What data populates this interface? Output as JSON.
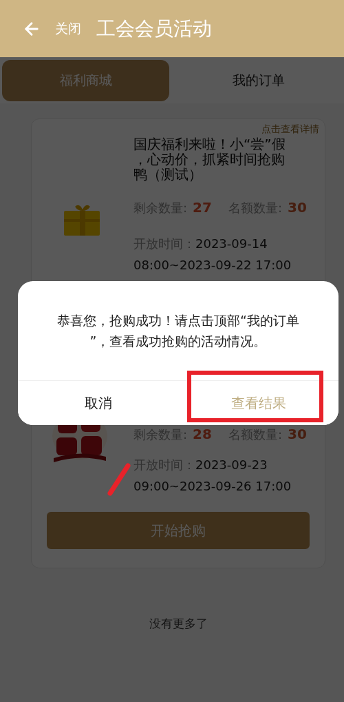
{
  "header": {
    "back_label": "关闭",
    "title": "工会会员活动"
  },
  "tabs": [
    {
      "label": "福利商城",
      "selected": true
    },
    {
      "label": "我的订单",
      "selected": false
    }
  ],
  "activities": [
    {
      "kind": "gift",
      "detail_link": "点击查看详情",
      "title": "国庆福利来啦！小“尝”假，心动价，抓紧时间抢购鸭（测试）",
      "remaining_label": "剩余数量:",
      "remaining": "27",
      "quota_label": "名额数量:",
      "quota": "30",
      "time_label": "开放时间：",
      "time_start": "2023-09-14",
      "time_end": "08:00~2023-09-22 17:00"
    },
    {
      "kind": "picture",
      "remaining_label": "剩余数量:",
      "remaining": "28",
      "quota_label": "名额数量:",
      "quota": "30",
      "time_label": "开放时间：",
      "time_start": "2023-09-23",
      "time_end": "09:00~2023-09-26 17:00",
      "button": "开始抢购"
    }
  ],
  "footer": "没有更多了",
  "dialog": {
    "message": "恭喜您，抢购成功！请点击顶部“我的订单”，查看成功抢购的活动情况。",
    "buttons": [
      {
        "label": "取消",
        "kind": "cancel"
      },
      {
        "label": "查看结果",
        "kind": "confirm"
      }
    ]
  }
}
